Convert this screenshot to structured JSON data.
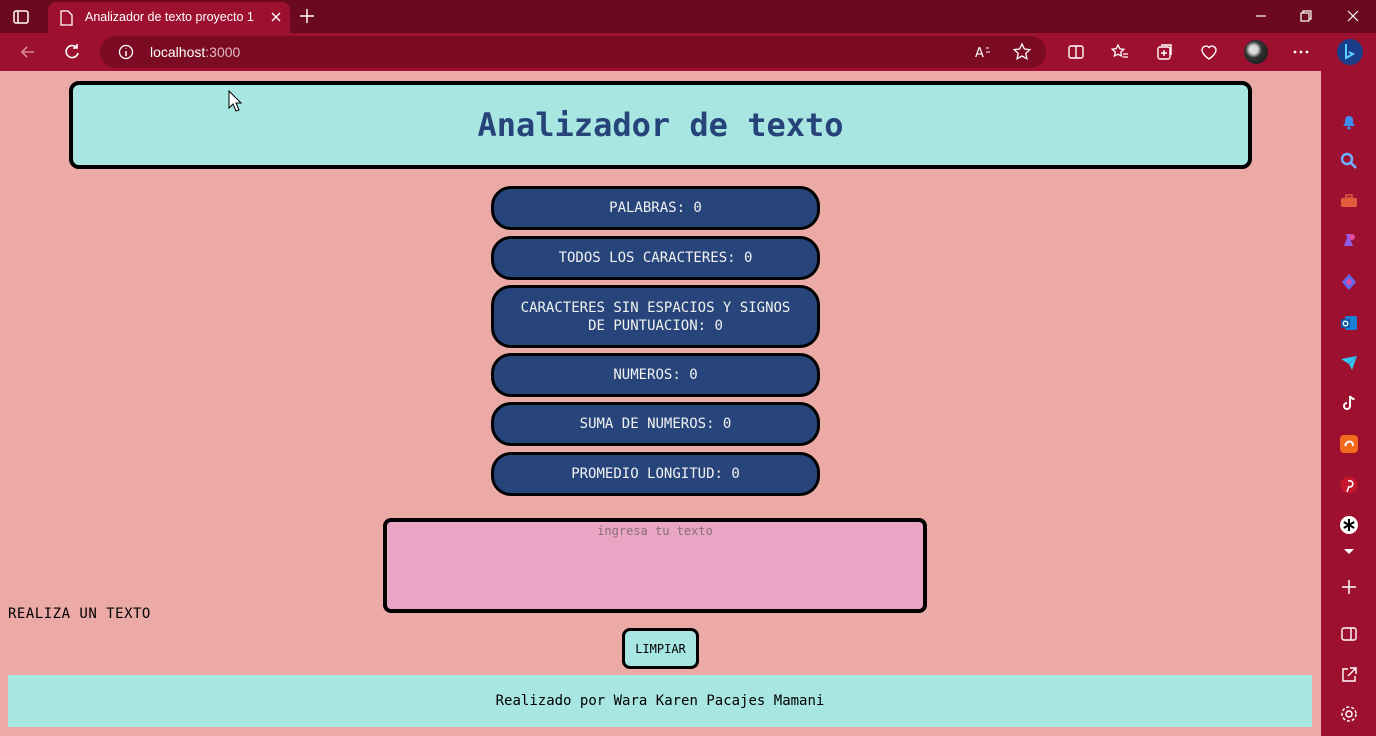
{
  "browser": {
    "tab_title": "Analizador de texto proyecto 1",
    "url_host": "localhost",
    "url_port": ":3000"
  },
  "page": {
    "title": "Analizador de texto",
    "stats": [
      {
        "label": "PALABRAS: 0"
      },
      {
        "label": "TODOS LOS CARACTERES: 0"
      },
      {
        "label": "CARACTERES SIN ESPACIOS Y SIGNOS DE PUNTUACION: 0"
      },
      {
        "label": "NUMEROS: 0"
      },
      {
        "label": "SUMA DE NUMEROS: 0"
      },
      {
        "label": "PROMEDIO LONGITUD: 0"
      }
    ],
    "textarea": {
      "placeholder": "ingresa tu texto",
      "value": ""
    },
    "side_message": "REALIZA UN TEXTO",
    "clear_button": "LIMPIAR",
    "footer": "Realizado por Wara Karen Pacajes Mamani"
  },
  "colors": {
    "page_bg": "#ecaaa7",
    "header_bg": "#a8e6e2",
    "title_color": "#27447a",
    "stat_bg": "#27457a",
    "textarea_bg": "#e8a6c4",
    "browser_frame": "#9e1030"
  },
  "icons": {
    "sidebar": [
      "bell-icon",
      "search-icon",
      "toolbox-icon",
      "chess-icon",
      "copilot-icon",
      "outlook-icon",
      "send-icon",
      "tiktok-icon",
      "office-icon",
      "pinterest-icon",
      "asterisk-icon",
      "chevron-down-icon",
      "plus-icon",
      "split-screen-icon",
      "external-link-icon",
      "gear-icon"
    ]
  }
}
